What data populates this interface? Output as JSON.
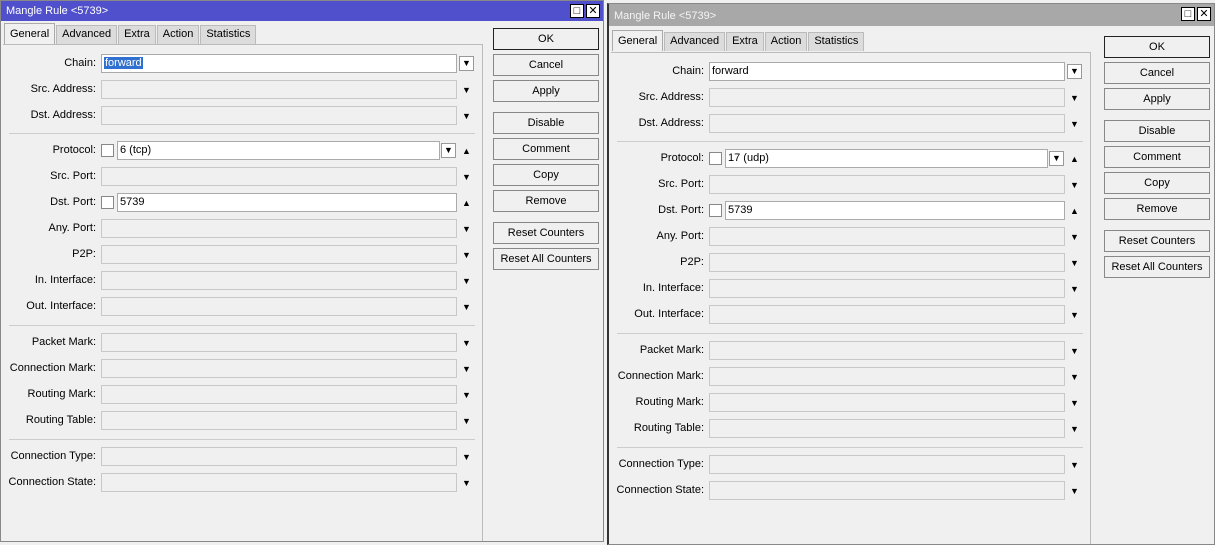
{
  "windows": [
    {
      "title": "Mangle Rule <5739>",
      "active": true,
      "tabs": [
        "General",
        "Advanced",
        "Extra",
        "Action",
        "Statistics"
      ],
      "fields": [
        {
          "label": "Chain:",
          "value": "forward",
          "selected": true,
          "kind": "combo"
        },
        {
          "label": "Src. Address:",
          "value": ""
        },
        {
          "label": "Dst. Address:",
          "value": ""
        },
        {
          "label": "Protocol:",
          "value": "6 (tcp)",
          "kind": "proto"
        },
        {
          "label": "Src. Port:",
          "value": ""
        },
        {
          "label": "Dst. Port:",
          "value": "5739",
          "kind": "check"
        },
        {
          "label": "Any. Port:",
          "value": ""
        },
        {
          "label": "P2P:",
          "value": ""
        },
        {
          "label": "In. Interface:",
          "value": ""
        },
        {
          "label": "Out. Interface:",
          "value": ""
        },
        {
          "label": "Packet Mark:",
          "value": ""
        },
        {
          "label": "Connection Mark:",
          "value": ""
        },
        {
          "label": "Routing Mark:",
          "value": ""
        },
        {
          "label": "Routing Table:",
          "value": ""
        },
        {
          "label": "Connection Type:",
          "value": ""
        },
        {
          "label": "Connection State:",
          "value": ""
        }
      ],
      "buttons": [
        "OK",
        "Cancel",
        "Apply",
        "Disable",
        "Comment",
        "Copy",
        "Remove",
        "Reset Counters",
        "Reset All Counters"
      ]
    },
    {
      "title": "Mangle Rule <5739>",
      "active": false,
      "tabs": [
        "General",
        "Advanced",
        "Extra",
        "Action",
        "Statistics"
      ],
      "fields": [
        {
          "label": "Chain:",
          "value": "forward",
          "kind": "combo"
        },
        {
          "label": "Src. Address:",
          "value": ""
        },
        {
          "label": "Dst. Address:",
          "value": ""
        },
        {
          "label": "Protocol:",
          "value": "17 (udp)",
          "kind": "proto"
        },
        {
          "label": "Src. Port:",
          "value": ""
        },
        {
          "label": "Dst. Port:",
          "value": "5739",
          "kind": "check"
        },
        {
          "label": "Any. Port:",
          "value": ""
        },
        {
          "label": "P2P:",
          "value": ""
        },
        {
          "label": "In. Interface:",
          "value": ""
        },
        {
          "label": "Out. Interface:",
          "value": ""
        },
        {
          "label": "Packet Mark:",
          "value": ""
        },
        {
          "label": "Connection Mark:",
          "value": ""
        },
        {
          "label": "Routing Mark:",
          "value": ""
        },
        {
          "label": "Routing Table:",
          "value": ""
        },
        {
          "label": "Connection Type:",
          "value": ""
        },
        {
          "label": "Connection State:",
          "value": ""
        }
      ],
      "buttons": [
        "OK",
        "Cancel",
        "Apply",
        "Disable",
        "Comment",
        "Copy",
        "Remove",
        "Reset Counters",
        "Reset All Counters"
      ]
    }
  ]
}
